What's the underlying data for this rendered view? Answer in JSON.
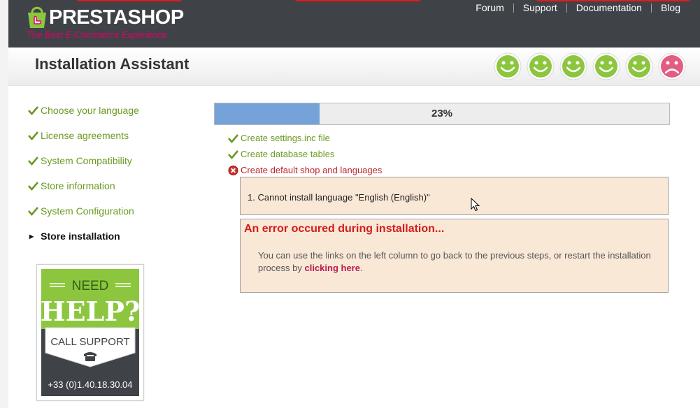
{
  "brand": {
    "logo_text": "PRESTASHOP",
    "tagline": "The Best E-Commerce Experience",
    "accent": "#df0067",
    "topbar_color": "#3f4348"
  },
  "nav": {
    "links": [
      "Forum",
      "Support",
      "Documentation",
      "Blog"
    ]
  },
  "header": {
    "title": "Installation Assistant",
    "faces": [
      "happy",
      "happy",
      "happy",
      "happy",
      "happy",
      "sad"
    ]
  },
  "steps": [
    {
      "label": "Choose your language",
      "state": "done"
    },
    {
      "label": "License agreements",
      "state": "done"
    },
    {
      "label": "System Compatibility",
      "state": "done"
    },
    {
      "label": "Store information",
      "state": "done"
    },
    {
      "label": "System Configuration",
      "state": "done"
    },
    {
      "label": "Store installation",
      "state": "current"
    }
  ],
  "help": {
    "need": "NEED",
    "help": "HELP?",
    "call": "CALL SUPPORT",
    "phone": "+33 (0)1.40.18.30.04"
  },
  "progress": {
    "percent_label": "23%",
    "fraction": 0.23,
    "fill_color": "#75a2d8"
  },
  "tasks": [
    {
      "label": "Create settings.inc file",
      "status": "ok"
    },
    {
      "label": "Create database tables",
      "status": "ok"
    },
    {
      "label": "Create default shop and languages",
      "status": "error"
    }
  ],
  "errors": {
    "items": [
      "1.   Cannot install language \"English (English)\""
    ]
  },
  "error_box": {
    "title": "An error occured during installation...",
    "message": "You can use the links on the left column to go back to the previous steps, or restart the installation process by ",
    "link": "clicking here",
    "suffix": "."
  }
}
